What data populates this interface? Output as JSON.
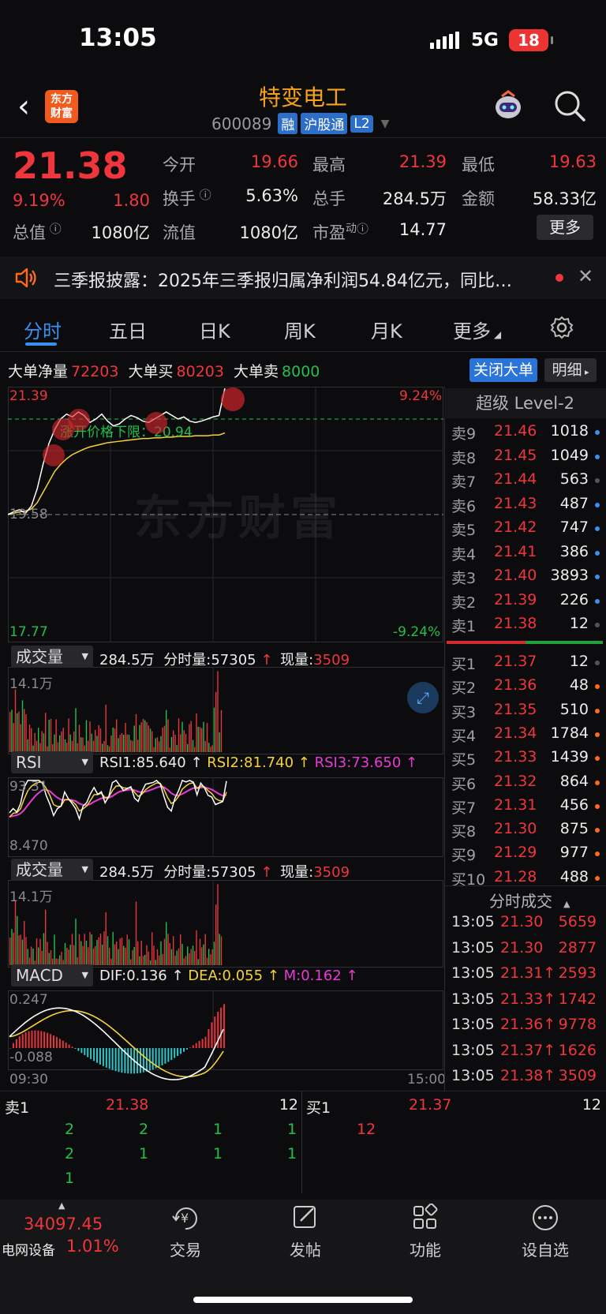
{
  "status": {
    "time": "13:05",
    "network": "5G",
    "battery": "18"
  },
  "header": {
    "logo": "东方财富",
    "name": "特变电工",
    "code": "600089",
    "tags": [
      "融",
      "沪股通",
      "L2"
    ]
  },
  "quote": {
    "price": "21.38",
    "pct": "9.19%",
    "change": "1.80",
    "open_label": "今开",
    "open": "19.66",
    "high_label": "最高",
    "high": "21.39",
    "low_label": "最低",
    "low": "19.63",
    "turnover_label": "换手",
    "turnover": "5.63%",
    "volume_label": "总手",
    "volume": "284.5万",
    "amount_label": "金额",
    "amount": "58.33亿",
    "mktcap_label": "总值",
    "mktcap": "1080亿",
    "float_label": "流值",
    "float": "1080亿",
    "pe_label": "市盈",
    "pe_sup": "动",
    "pe": "14.77",
    "more": "更多"
  },
  "notice": {
    "text": "三季报披露：2025年三季报归属净利润54.84亿元，同比…"
  },
  "tabs": [
    "分时",
    "五日",
    "日K",
    "周K",
    "月K",
    "更多"
  ],
  "bigorder": {
    "net_label": "大单净量",
    "net": "72203",
    "buy_label": "大单买",
    "buy": "80203",
    "sell_label": "大单卖",
    "sell": "8000",
    "close_btn": "关闭大单",
    "detail_btn": "明细"
  },
  "intraday": {
    "top": "21.39",
    "top_pct": "9.24%",
    "base": "19.58",
    "bottom": "17.77",
    "bottom_pct": "-9.24%",
    "annotation": "涨开价格下限：20.94",
    "watermark": "东方财富",
    "time_start": "09:30",
    "time_end": "15:00"
  },
  "vol_panel": {
    "selector": "成交量",
    "total": "284.5万",
    "minute_label": "分时量:",
    "minute": "57305",
    "now_label": "现量:",
    "now": "3509",
    "max": "14.1万"
  },
  "rsi_panel": {
    "selector": "RSI",
    "rsi1": "RSI1:85.640",
    "rsi2": "RSI2:81.740",
    "rsi3": "RSI3:73.650",
    "top": "93.31",
    "bottom": "8.470"
  },
  "macd_panel": {
    "selector": "MACD",
    "dif": "DIF:0.136",
    "dea": "DEA:0.055",
    "m": "M:0.162",
    "top": "0.247",
    "bottom": "-0.088"
  },
  "orderbook": {
    "title": "超级 Level-2",
    "asks": [
      {
        "label": "卖9",
        "price": "21.46",
        "vol": "1018"
      },
      {
        "label": "卖8",
        "price": "21.45",
        "vol": "1049"
      },
      {
        "label": "卖7",
        "price": "21.44",
        "vol": "563"
      },
      {
        "label": "卖6",
        "price": "21.43",
        "vol": "487"
      },
      {
        "label": "卖5",
        "price": "21.42",
        "vol": "747"
      },
      {
        "label": "卖4",
        "price": "21.41",
        "vol": "386"
      },
      {
        "label": "卖3",
        "price": "21.40",
        "vol": "3893"
      },
      {
        "label": "卖2",
        "price": "21.39",
        "vol": "226"
      },
      {
        "label": "卖1",
        "price": "21.38",
        "vol": "12"
      }
    ],
    "bids": [
      {
        "label": "买1",
        "price": "21.37",
        "vol": "12"
      },
      {
        "label": "买2",
        "price": "21.36",
        "vol": "48"
      },
      {
        "label": "买3",
        "price": "21.35",
        "vol": "510"
      },
      {
        "label": "买4",
        "price": "21.34",
        "vol": "1784"
      },
      {
        "label": "买5",
        "price": "21.33",
        "vol": "1439"
      },
      {
        "label": "买6",
        "price": "21.32",
        "vol": "864"
      },
      {
        "label": "买7",
        "price": "21.31",
        "vol": "456"
      },
      {
        "label": "买8",
        "price": "21.30",
        "vol": "875"
      },
      {
        "label": "买9",
        "price": "21.29",
        "vol": "977"
      },
      {
        "label": "买10",
        "price": "21.28",
        "vol": "488"
      }
    ],
    "ask_dot_colors": [
      "#3a8ff2",
      "#3a8ff2",
      "#555",
      "#3a8ff2",
      "#3a8ff2",
      "#3a8ff2",
      "#3a8ff2",
      "#3a8ff2",
      "#555"
    ],
    "bid_dot_colors": [
      "#555",
      "#ff6a1a",
      "#ff6a1a",
      "#ff6a1a",
      "#ff6a1a",
      "#ff6a1a",
      "#ff6a1a",
      "#ff6a1a",
      "#ff6a1a",
      "#ff6a1a"
    ]
  },
  "ticks": {
    "title": "分时成交",
    "rows": [
      {
        "time": "13:05",
        "price": "21.30",
        "vol": "5659"
      },
      {
        "time": "13:05",
        "price": "21.30",
        "vol": "2877"
      },
      {
        "time": "13:05",
        "price": "21.31↑",
        "vol": "2593"
      },
      {
        "time": "13:05",
        "price": "21.33↑",
        "vol": "1742"
      },
      {
        "time": "13:05",
        "price": "21.36↑",
        "vol": "9778"
      },
      {
        "time": "13:05",
        "price": "21.37↑",
        "vol": "1626"
      },
      {
        "time": "13:05",
        "price": "21.38↑",
        "vol": "3509"
      }
    ]
  },
  "queue": {
    "sell_label": "卖1",
    "sell_price": "21.38",
    "sell_count": "12",
    "buy_label": "买1",
    "buy_price": "21.37",
    "buy_count": "12",
    "sell_rows": [
      [
        "2",
        "2",
        "1",
        "1"
      ],
      [
        "2",
        "1",
        "1",
        "1"
      ],
      [
        "1"
      ]
    ],
    "buy_rows": [
      [
        "12"
      ]
    ]
  },
  "bottom": {
    "index_value": "34097.45",
    "index_name": "电网设备",
    "index_pct": "1.01%",
    "nav": [
      "交易",
      "发帖",
      "功能",
      "设自选"
    ]
  },
  "chart_data": {
    "type": "line",
    "note_series": "intraday price with average price line",
    "price": [
      19.58,
      19.62,
      19.65,
      19.6,
      19.7,
      19.95,
      20.3,
      20.6,
      20.8,
      20.95,
      21.02,
      20.98,
      21.05,
      21.0,
      20.9,
      20.95,
      21.02,
      20.92,
      20.85,
      20.88,
      20.95,
      21.0,
      20.97,
      20.92,
      20.9,
      20.95,
      21.0,
      21.05,
      21.0,
      20.95,
      20.98,
      20.92,
      20.9,
      20.92,
      20.95,
      20.98,
      21.0,
      21.39
    ],
    "avg": [
      19.58,
      19.6,
      19.62,
      19.63,
      19.66,
      19.75,
      19.9,
      20.05,
      20.2,
      20.3,
      20.38,
      20.44,
      20.48,
      20.52,
      20.55,
      20.57,
      20.59,
      20.61,
      20.62,
      20.63,
      20.64,
      20.65,
      20.66,
      20.67,
      20.67,
      20.68,
      20.68,
      20.69,
      20.69,
      20.7,
      20.7,
      20.7,
      20.71,
      20.71,
      20.71,
      20.72,
      20.72,
      20.75
    ],
    "ylim": [
      17.77,
      21.39
    ]
  }
}
